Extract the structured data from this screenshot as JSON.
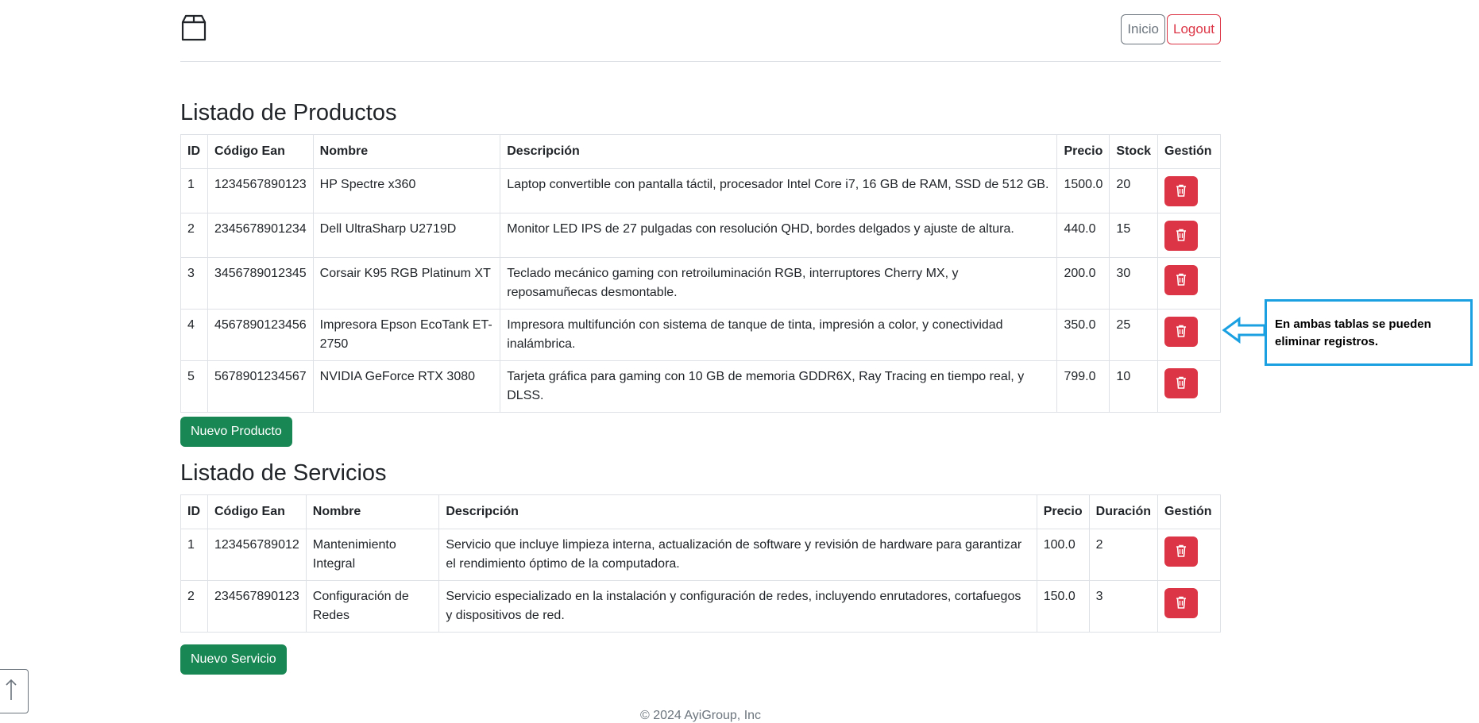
{
  "header": {
    "logo_icon": "box-icon",
    "nav": {
      "home_label": "Inicio",
      "logout_label": "Logout"
    }
  },
  "products": {
    "title": "Listado de Productos",
    "columns": [
      "ID",
      "Código Ean",
      "Nombre",
      "Descripción",
      "Precio",
      "Stock",
      "Gestión"
    ],
    "rows": [
      {
        "id": "1",
        "ean": "1234567890123",
        "name": "HP Spectre x360",
        "desc": "Laptop convertible con pantalla táctil, procesador Intel Core i7, 16 GB de RAM, SSD de 512 GB.",
        "price": "1500.0",
        "stock": "20"
      },
      {
        "id": "2",
        "ean": "2345678901234",
        "name": "Dell UltraSharp U2719D",
        "desc": "Monitor LED IPS de 27 pulgadas con resolución QHD, bordes delgados y ajuste de altura.",
        "price": "440.0",
        "stock": "15"
      },
      {
        "id": "3",
        "ean": "3456789012345",
        "name": "Corsair K95 RGB Platinum XT",
        "desc": "Teclado mecánico gaming con retroiluminación RGB, interruptores Cherry MX, y reposamuñecas desmontable.",
        "price": "200.0",
        "stock": "30"
      },
      {
        "id": "4",
        "ean": "4567890123456",
        "name": "Impresora Epson EcoTank ET-2750",
        "desc": "Impresora multifunción con sistema de tanque de tinta, impresión a color, y conectividad inalámbrica.",
        "price": "350.0",
        "stock": "25"
      },
      {
        "id": "5",
        "ean": "5678901234567",
        "name": "NVIDIA GeForce RTX 3080",
        "desc": "Tarjeta gráfica para gaming con 10 GB de memoria GDDR6X, Ray Tracing en tiempo real, y DLSS.",
        "price": "799.0",
        "stock": "10"
      }
    ],
    "new_button_label": "Nuevo Producto"
  },
  "services": {
    "title": "Listado de Servicios",
    "columns": [
      "ID",
      "Código Ean",
      "Nombre",
      "Descripción",
      "Precio",
      "Duración",
      "Gestión"
    ],
    "rows": [
      {
        "id": "1",
        "ean": "123456789012",
        "name": "Mantenimiento Integral",
        "desc": "Servicio que incluye limpieza interna, actualización de software y revisión de hardware para garantizar el rendimiento óptimo de la computadora.",
        "price": "100.0",
        "duration": "2"
      },
      {
        "id": "2",
        "ean": "234567890123",
        "name": "Configuración de Redes",
        "desc": "Servicio especializado en la instalación y configuración de redes, incluyendo enrutadores, cortafuegos y dispositivos de red.",
        "price": "150.0",
        "duration": "3"
      }
    ],
    "new_button_label": "Nuevo Servicio"
  },
  "callout": {
    "text": "En ambas tablas se pueden eliminar registros."
  },
  "footer": {
    "text": "© 2024 AyiGroup, Inc"
  },
  "colors": {
    "danger": "#dc3545",
    "success": "#198754",
    "callout_border": "#1ba1e2"
  }
}
